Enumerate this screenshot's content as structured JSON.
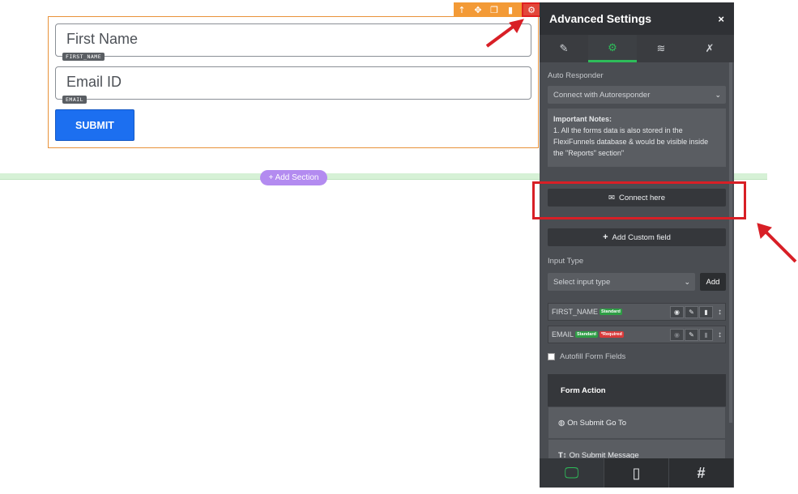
{
  "form": {
    "toolbar": {
      "icons": [
        "up-arrow-icon",
        "move-icon",
        "duplicate-icon",
        "trash-icon",
        "gear-icon"
      ]
    },
    "fields": [
      {
        "placeholder": "First Name",
        "tag": "FIRST_NAME"
      },
      {
        "placeholder": "Email ID",
        "tag": "EMAIL"
      }
    ],
    "submit_label": "SUBMIT"
  },
  "canvas": {
    "add_section_label": "+ Add Section"
  },
  "panel": {
    "title": "Advanced Settings",
    "close": "×",
    "tabs": [
      {
        "icon": "brush-icon",
        "glyph": "✎"
      },
      {
        "icon": "gear-icon",
        "glyph": "⚙"
      },
      {
        "icon": "layers-icon",
        "glyph": "≋"
      },
      {
        "icon": "running-icon",
        "glyph": "✗"
      }
    ],
    "auto_responder": {
      "label": "Auto Responder",
      "select_value": "Connect with Autoresponder"
    },
    "notes": {
      "title": "Important Notes:",
      "text": "1. All the forms data is also stored in the FlexiFunnels database & would be visible inside the \"Reports\" section\""
    },
    "connect_label": "Connect here",
    "add_custom_field_label": "Add Custom field",
    "input_type": {
      "label": "Input Type",
      "select_value": "Select input type",
      "add_label": "Add"
    },
    "field_rows": [
      {
        "name": "FIRST_NAME",
        "badges": [
          {
            "text": "Standard",
            "color": "green"
          }
        ]
      },
      {
        "name": "EMAIL",
        "badges": [
          {
            "text": "Standard",
            "color": "green"
          },
          {
            "text": "*Required",
            "color": "red"
          }
        ]
      }
    ],
    "autofill_label": "Autofill Form Fields",
    "form_action": {
      "header": "Form Action",
      "items": [
        {
          "label": "On Submit Go To",
          "icon": "globe-icon"
        },
        {
          "label": "On Submit Message",
          "icon": "text-icon"
        }
      ]
    },
    "footer": [
      "desktop-icon",
      "mobile-icon",
      "hash-icon"
    ]
  },
  "colors": {
    "accent_green": "#2ebd5a",
    "toolbar_orange": "#f39a36",
    "submit_blue": "#1c6ff0",
    "annotation_red": "#d81f26"
  }
}
